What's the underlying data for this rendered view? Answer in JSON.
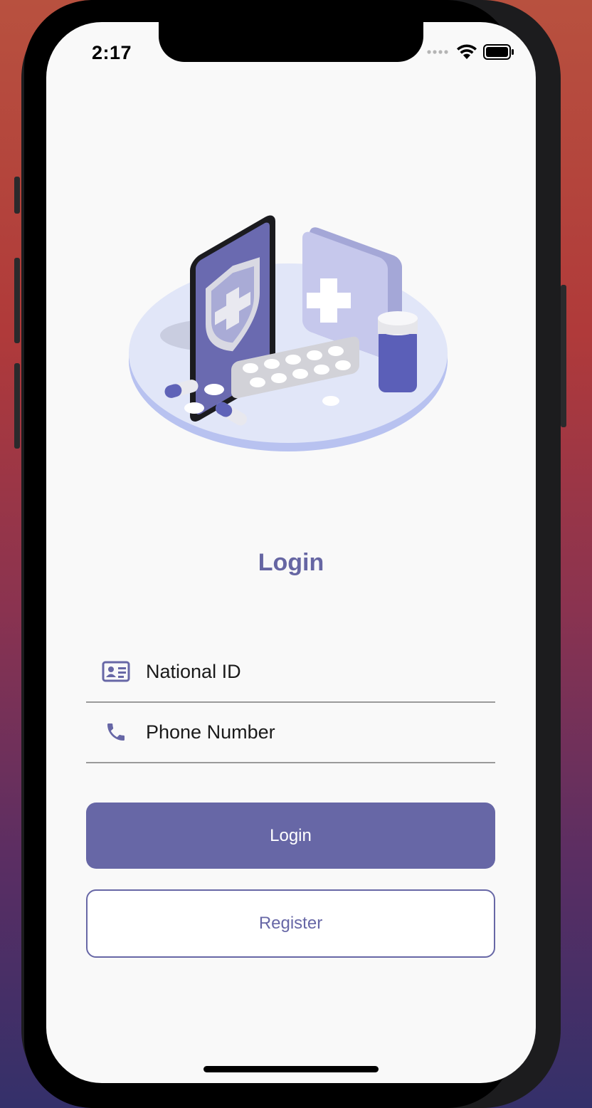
{
  "status_bar": {
    "time": "2:17"
  },
  "page": {
    "title": "Login"
  },
  "form": {
    "national_id_placeholder": "National ID",
    "phone_placeholder": "Phone Number"
  },
  "actions": {
    "login_label": "Login",
    "register_label": "Register"
  },
  "colors": {
    "accent": "#6767a6",
    "background": "#f9f9f9",
    "divider": "#9a9a9a"
  },
  "icons": {
    "national_id": "id-card-icon",
    "phone": "phone-icon",
    "signal": "cellular-signal-icon",
    "wifi": "wifi-icon",
    "battery": "battery-icon"
  }
}
